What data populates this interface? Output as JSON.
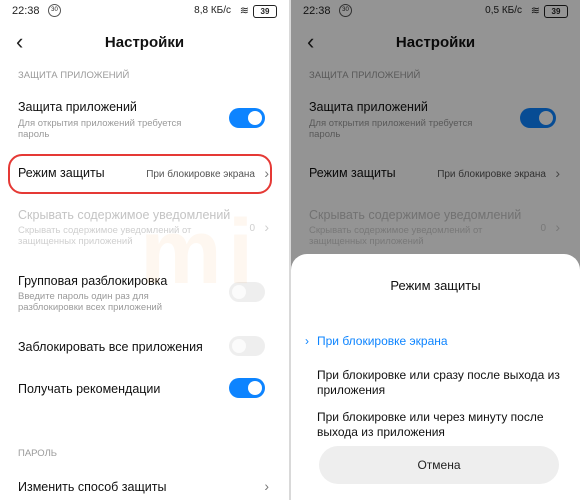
{
  "left": {
    "status": {
      "time": "22:38",
      "notif": "30",
      "speed": "8,8 КБ/с",
      "battery": "39"
    },
    "title": "Настройки",
    "section_app": "ЗАЩИТА ПРИЛОЖЕНИЙ",
    "app_protection": {
      "label": "Защита приложений",
      "sub": "Для открытия приложений требуется пароль",
      "toggle": "on"
    },
    "protection_mode": {
      "label": "Режим защиты",
      "value": "При блокировке экрана"
    },
    "hide_content": {
      "label": "Скрывать содержимое уведомлений",
      "sub": "Скрывать содержимое уведомлений от защищенных приложений",
      "value": "0"
    },
    "group_unlock": {
      "label": "Групповая разблокировка",
      "sub": "Введите пароль один раз для разблокировки всех приложений",
      "toggle": "off"
    },
    "lock_all": {
      "label": "Заблокировать все приложения",
      "toggle": "off"
    },
    "recommendations": {
      "label": "Получать рекомендации",
      "toggle": "on"
    },
    "section_password": "ПАРОЛЬ",
    "change_method": {
      "label": "Изменить способ защиты"
    }
  },
  "right": {
    "status": {
      "time": "22:38",
      "notif": "30",
      "speed": "0,5 КБ/с",
      "battery": "39"
    },
    "title": "Настройки",
    "section_app": "ЗАЩИТА ПРИЛОЖЕНИЙ",
    "app_protection": {
      "label": "Защита приложений",
      "sub": "Для открытия приложений требуется пароль"
    },
    "protection_mode": {
      "label": "Режим защиты",
      "value": "При блокировке экрана"
    },
    "hide_content": {
      "label": "Скрывать содержимое уведомлений",
      "sub": "Скрывать содержимое уведомлений от защищенных приложений",
      "value": "0"
    },
    "sheet": {
      "title": "Режим защиты",
      "options": [
        {
          "label": "При блокировке экрана",
          "selected": true
        },
        {
          "label": "При блокировке или сразу после выхода из приложения",
          "selected": false
        },
        {
          "label": "При блокировке или через минуту после выхода из приложения",
          "selected": false
        }
      ],
      "cancel": "Отмена"
    }
  },
  "watermark": "mi geek",
  "colors": {
    "accent": "#0d84ff",
    "highlight": "#e53935"
  }
}
